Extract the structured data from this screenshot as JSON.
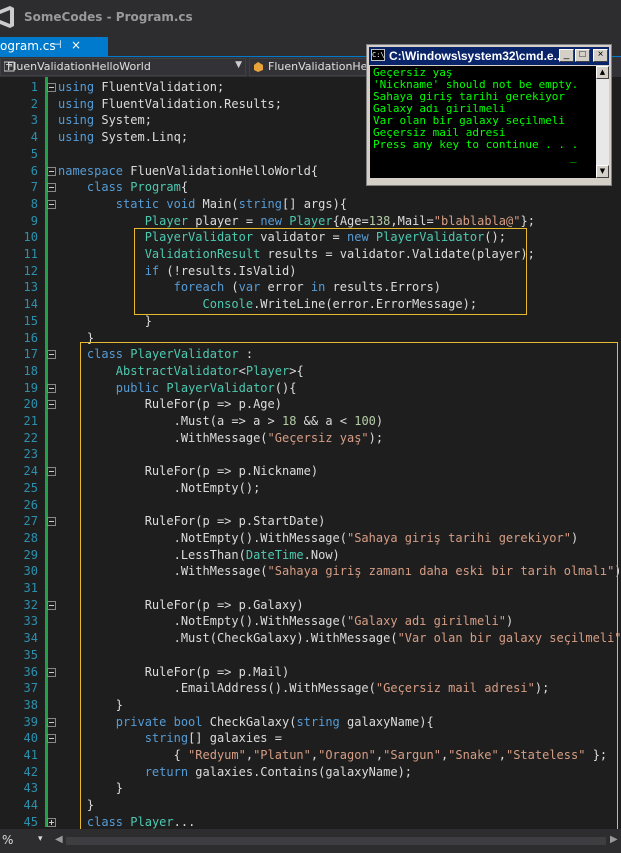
{
  "app": {
    "title": "SomeCodes - Program.cs"
  },
  "tab": {
    "label": "ogram.cs",
    "pin": "⊣",
    "close": "×"
  },
  "nav": {
    "left": "FluenValidationHelloWorld",
    "right": "FluenValidationHello"
  },
  "console": {
    "title": "C:\\Windows\\system32\\cmd.e...",
    "minimize": "_",
    "maximize": "□",
    "close": "×",
    "lines": [
      "Geçersiz yaş",
      "'Nickname' should not be empty.",
      "Sahaya giriş tarihi gerekiyor",
      "Galaxy adı girilmeli",
      "Var olan bir galaxy seçilmeli",
      "Geçersiz mail adresi",
      "Press any key to continue . . ."
    ]
  },
  "editor": {
    "line_numbers": [
      "1",
      "2",
      "3",
      "4",
      "5",
      "6",
      "7",
      "8",
      "9",
      "10",
      "11",
      "12",
      "13",
      "14",
      "15",
      "16",
      "17",
      "18",
      "19",
      "20",
      "21",
      "22",
      "23",
      "24",
      "25",
      "26",
      "27",
      "28",
      "29",
      "30",
      "31",
      "32",
      "33",
      "34",
      "35",
      "36",
      "37",
      "38",
      "39",
      "40",
      "41",
      "42",
      "43",
      "44",
      "45"
    ],
    "lines": [
      "using FluentValidation;",
      "using FluentValidation.Results;",
      "using System;",
      "using System.Linq;",
      "",
      "namespace FluenValidationHelloWorld{",
      "    class Program{",
      "        static void Main(string[] args){",
      "            Player player = new Player{Age=138,Mail=\"blablabla@\"};",
      "            PlayerValidator validator = new PlayerValidator();",
      "            ValidationResult results = validator.Validate(player);",
      "            if (!results.IsValid)",
      "                foreach (var error in results.Errors)",
      "                    Console.WriteLine(error.ErrorMessage);",
      "            }",
      "    }",
      "    class PlayerValidator :",
      "        AbstractValidator<Player>{",
      "        public PlayerValidator(){",
      "            RuleFor(p => p.Age)",
      "                .Must(a => a > 18 && a < 100)",
      "                .WithMessage(\"Geçersiz yaş\");",
      "",
      "            RuleFor(p => p.Nickname)",
      "                .NotEmpty();",
      "",
      "            RuleFor(p => p.StartDate)",
      "                .NotEmpty().WithMessage(\"Sahaya giriş tarihi gerekiyor\")",
      "                .LessThan(DateTime.Now)",
      "                .WithMessage(\"Sahaya giriş zamanı daha eski bir tarih olmalı\");",
      "",
      "            RuleFor(p => p.Galaxy)",
      "                .NotEmpty().WithMessage(\"Galaxy adı girilmeli\")",
      "                .Must(CheckGalaxy).WithMessage(\"Var olan bir galaxy seçilmeli\");",
      "",
      "            RuleFor(p => p.Mail)",
      "                .EmailAddress().WithMessage(\"Geçersiz mail adresi\");",
      "        }",
      "        private bool CheckGalaxy(string galaxyName){",
      "            string[] galaxies =",
      "                { \"Redyum\",\"Platun\",\"Oragon\",\"Sargun\",\"Snake\",\"Stateless\" };",
      "            return galaxies.Contains(galaxyName);",
      "        }",
      "    }",
      "    class Player..."
    ]
  },
  "status": {
    "zoom": "%",
    "zoom_dd": "▾",
    "scroll_left": "◀",
    "scroll_right": "▶"
  }
}
